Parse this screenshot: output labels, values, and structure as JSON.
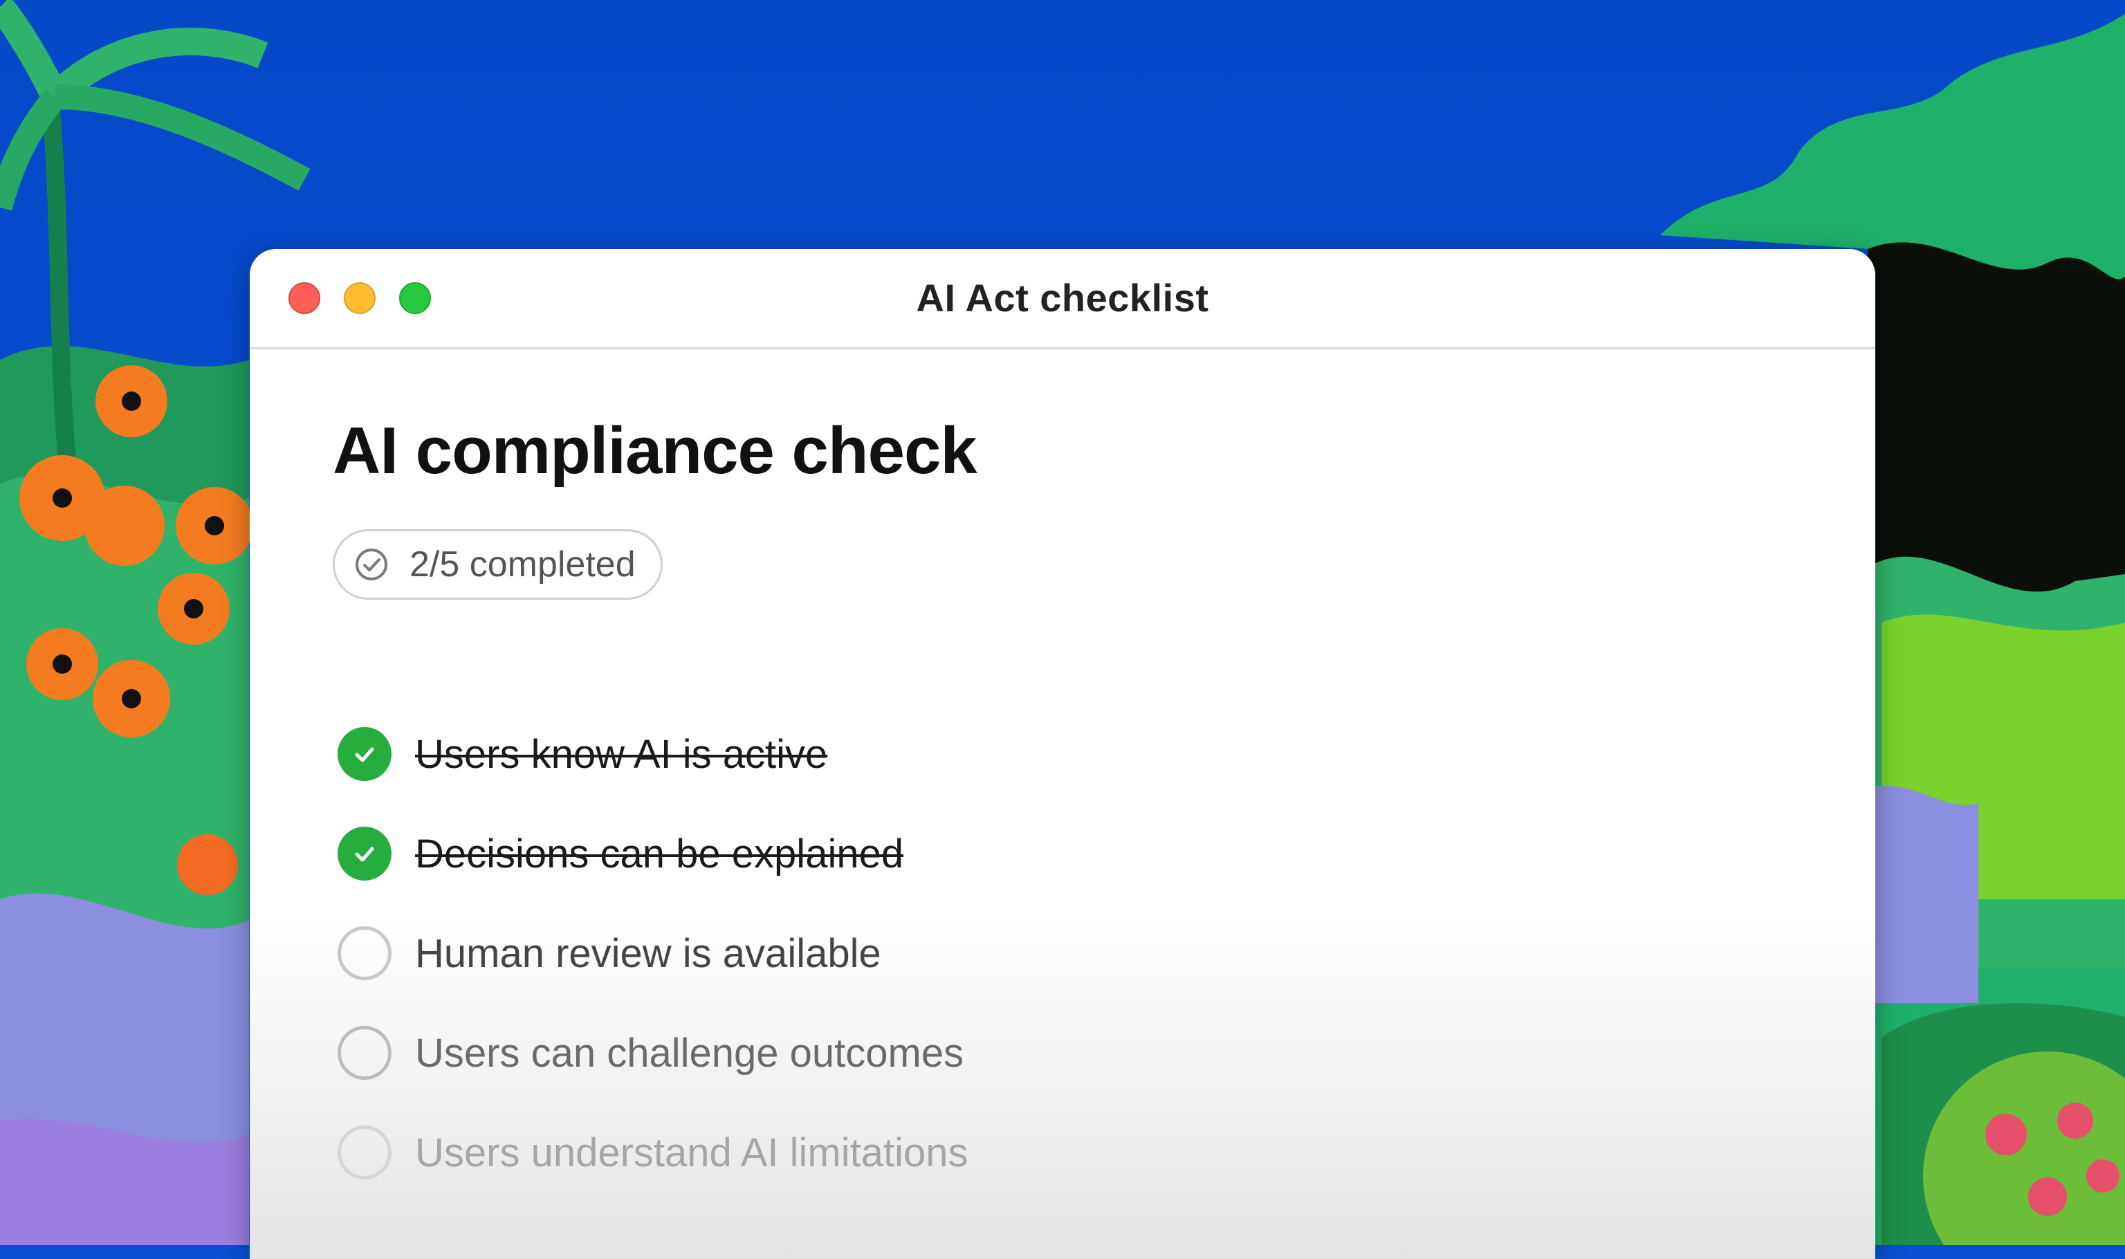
{
  "window": {
    "title": "AI Act checklist"
  },
  "page": {
    "title": "AI compliance check",
    "progress_label": "2/5 completed",
    "progress": {
      "completed": 2,
      "total": 5
    }
  },
  "checklist": {
    "items": [
      {
        "label": "Users know AI is active",
        "checked": true
      },
      {
        "label": "Decisions can be explained",
        "checked": true
      },
      {
        "label": "Human review is available",
        "checked": false
      },
      {
        "label": "Users can challenge outcomes",
        "checked": false
      },
      {
        "label": "Users understand AI limitations",
        "checked": false
      }
    ]
  },
  "icons": {
    "close": "traffic-light-red",
    "minimize": "traffic-light-yellow",
    "zoom": "traffic-light-green",
    "progress": "check-circle-outline-icon",
    "checked": "checkmark-icon"
  },
  "colors": {
    "desktop_sky": "#0548c8",
    "check_green": "#26ad3d",
    "traffic_red": "#ff5f57",
    "traffic_yellow": "#febc2e",
    "traffic_green": "#28c840"
  }
}
